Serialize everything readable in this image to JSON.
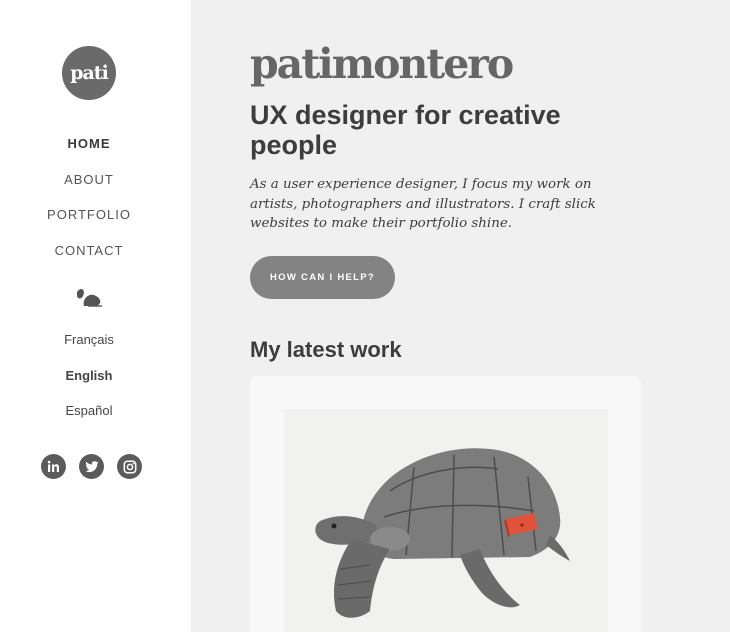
{
  "sidebar": {
    "logo_text": "pati",
    "nav": [
      {
        "label": "HOME",
        "active": true
      },
      {
        "label": "ABOUT",
        "active": false
      },
      {
        "label": "PORTFOLIO",
        "active": false
      },
      {
        "label": "CONTACT",
        "active": false
      }
    ],
    "divider_icon": "leaf-snail-icon",
    "languages": [
      {
        "label": "Français",
        "active": false
      },
      {
        "label": "English",
        "active": true
      },
      {
        "label": "Español",
        "active": false
      }
    ],
    "social": [
      "linkedin-icon",
      "twitter-icon",
      "instagram-icon"
    ]
  },
  "main": {
    "brand": "patimontero",
    "headline": "UX designer for creative people",
    "intro": "As a user experience designer, I focus my work on artists, photographers and illustrators. I craft slick websites to make their portfolio shine.",
    "cta_label": "HOW CAN I HELP?",
    "section_title": "My latest work",
    "work_image": "tortoise-illustration"
  },
  "colors": {
    "background": "#f0f0f0",
    "sidebar": "#ffffff",
    "logo": "#6a6a6a",
    "button": "#838383",
    "accent_drawer": "#e0523a"
  }
}
